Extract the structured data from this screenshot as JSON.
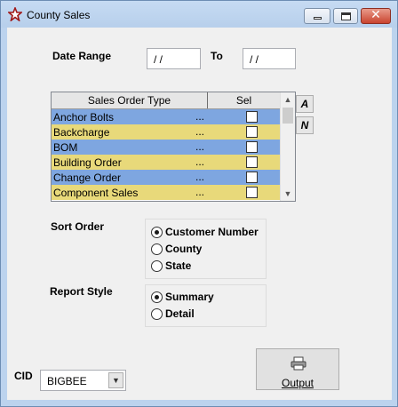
{
  "window": {
    "title": "County Sales",
    "close_symbol": "✕"
  },
  "date_range": {
    "label": "Date Range",
    "from_value": "/ /",
    "to_label": "To",
    "to_value": "/ /"
  },
  "grid": {
    "columns": [
      "Sales Order Type",
      "Sel"
    ],
    "rows": [
      {
        "name": "Anchor Bolts",
        "dots": "...",
        "color": "blue"
      },
      {
        "name": "Backcharge",
        "dots": "...",
        "color": "yellow"
      },
      {
        "name": "BOM",
        "dots": "...",
        "color": "blue"
      },
      {
        "name": "Building Order",
        "dots": "...",
        "color": "yellow"
      },
      {
        "name": "Change Order",
        "dots": "...",
        "color": "blue"
      },
      {
        "name": "Component Sales",
        "dots": "...",
        "color": "yellow"
      }
    ],
    "row_colors": {
      "blue": "#7ea6e0",
      "yellow": "#e8d97a"
    }
  },
  "side_buttons": {
    "all": "A",
    "none": "N"
  },
  "sort_order": {
    "label": "Sort Order",
    "options": [
      "Customer Number",
      "County",
      "State"
    ],
    "selected": "Customer Number"
  },
  "report_style": {
    "label": "Report  Style",
    "options": [
      "Summary",
      "Detail"
    ],
    "selected": "Summary"
  },
  "cid": {
    "label": "CID",
    "value": "BIGBEE"
  },
  "output": {
    "label": "Output",
    "icon": "printer-icon"
  }
}
